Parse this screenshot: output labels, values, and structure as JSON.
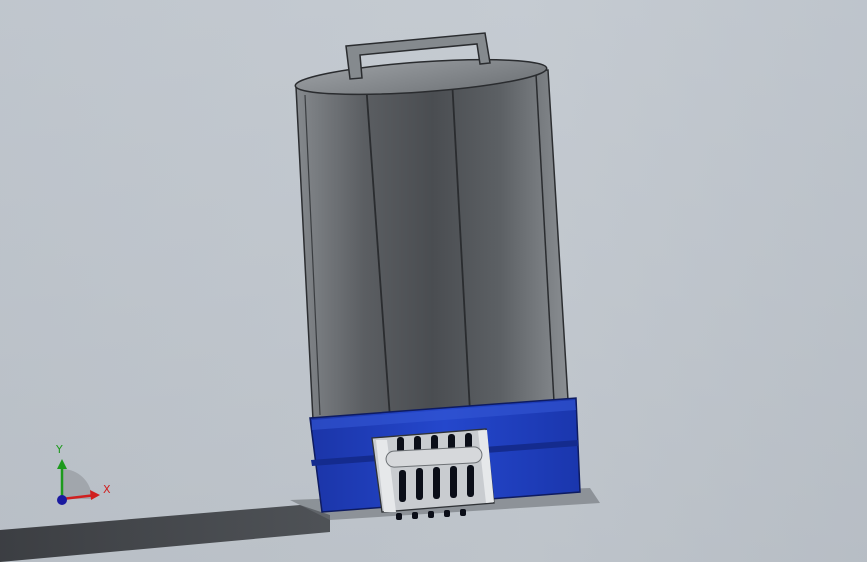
{
  "viewport": {
    "background_top": "#c4cad1",
    "background_bottom": "#b9bfc6"
  },
  "model": {
    "body_color": "#5a5d61",
    "body_highlight": "#7b7f83",
    "lid_color": "#84888c",
    "handle_color": "#7f8387",
    "base_color": "#1f3fb8",
    "base_highlight": "#3a5ee0",
    "grille_color": "#d8dadd",
    "slot_color": "#0b0e18",
    "shadow_color": "#2f3135"
  },
  "triad": {
    "x_label": "X",
    "y_label": "Y",
    "x_color": "#d01f1f",
    "y_color": "#1d9a1d",
    "z_color": "#1a1aa0"
  }
}
